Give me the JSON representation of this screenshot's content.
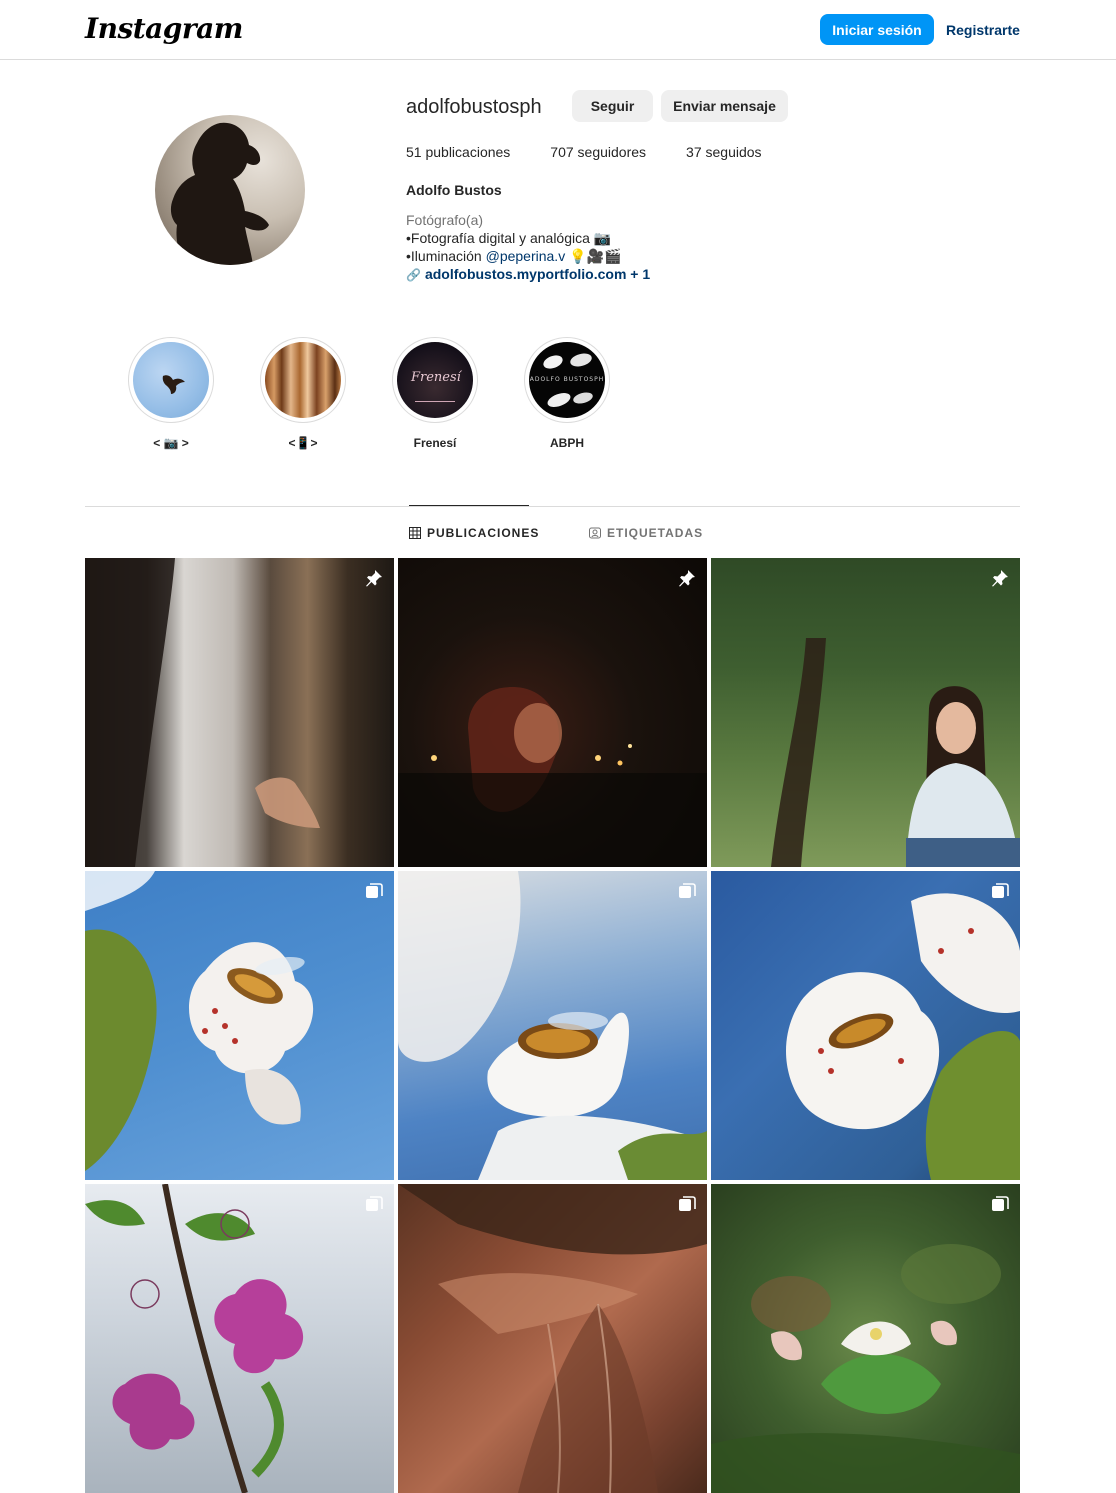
{
  "topnav": {
    "logo": "Instagram",
    "login_label": "Iniciar sesión",
    "register_label": "Registrarte"
  },
  "profile": {
    "username": "adolfobustosph",
    "follow_label": "Seguir",
    "message_label": "Enviar mensaje",
    "stats": {
      "posts": "51 publicaciones",
      "followers": "707 seguidores",
      "following": "37 seguidos"
    },
    "full_name": "Adolfo Bustos",
    "bio": {
      "category": "Fotógrafo(a)",
      "line1": "•Fotografía digital y analógica 📷",
      "line2_prefix": "•Iluminación ",
      "line2_mention": "@peperina.v",
      "line2_suffix": " 💡🎥🎬",
      "link_text": "adolfobustos.myportfolio.com",
      "link_extra": " + 1"
    }
  },
  "highlights": [
    {
      "label": "< 📷 >"
    },
    {
      "label": "<📱>"
    },
    {
      "label": "Frenesí"
    },
    {
      "label": "ABPH"
    }
  ],
  "highlight_text": {
    "frenesi_logo": "Frenesí",
    "abph_text": "ADOLFO BUSTOSPH"
  },
  "tabs": {
    "posts": "PUBLICACIONES",
    "tagged": "ETIQUETADAS"
  },
  "posts": [
    {
      "type": "pinned"
    },
    {
      "type": "pinned"
    },
    {
      "type": "pinned"
    },
    {
      "type": "carousel"
    },
    {
      "type": "carousel"
    },
    {
      "type": "carousel"
    },
    {
      "type": "carousel"
    },
    {
      "type": "carousel"
    },
    {
      "type": "carousel"
    }
  ],
  "colors": {
    "accent": "#0095f6",
    "link": "#00376b",
    "border": "#dbdbdb",
    "secondary_text": "#737373"
  }
}
